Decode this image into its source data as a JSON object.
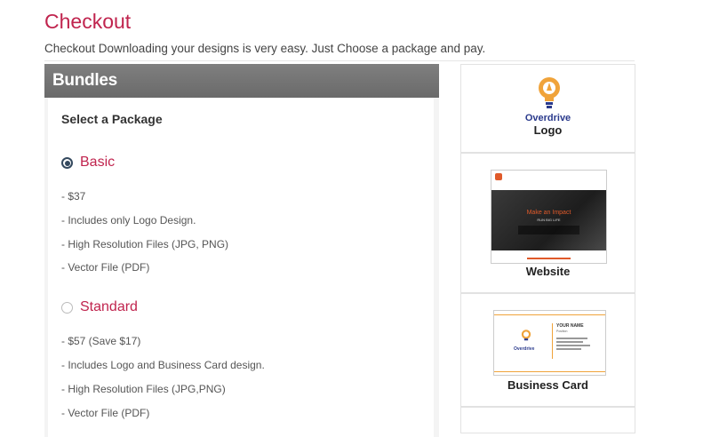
{
  "title": "Checkout",
  "subtitle": "Checkout Downloading your designs is very easy. Just Choose a package and pay.",
  "bundles": {
    "header": "Bundles",
    "select_label": "Select a Package",
    "packages": [
      {
        "name": "Basic",
        "selected": true,
        "features": [
          "- $37",
          "- Includes only Logo Design.",
          "- High Resolution Files (JPG, PNG)",
          "- Vector File (PDF)"
        ]
      },
      {
        "name": "Standard",
        "selected": false,
        "features": [
          "- $57 (Save $17)",
          "- Includes Logo and Business Card design.",
          "- High Resolution Files (JPG,PNG)",
          "- Vector File (PDF)"
        ]
      }
    ]
  },
  "sidebar": {
    "logo": {
      "brand": "Overdrive",
      "label": "Logo"
    },
    "website": {
      "label": "Website",
      "hero_text": "Make an Impact",
      "hero_sub": "RUN BIG LIFE"
    },
    "business_card": {
      "label": "Business Card",
      "name": "YOUR NAME",
      "title": "Position",
      "brand": "Overdrive"
    }
  },
  "colors": {
    "accent": "#c0244e",
    "header": "#737373",
    "radio": "#34495e",
    "bulb": "#f0a33a"
  }
}
